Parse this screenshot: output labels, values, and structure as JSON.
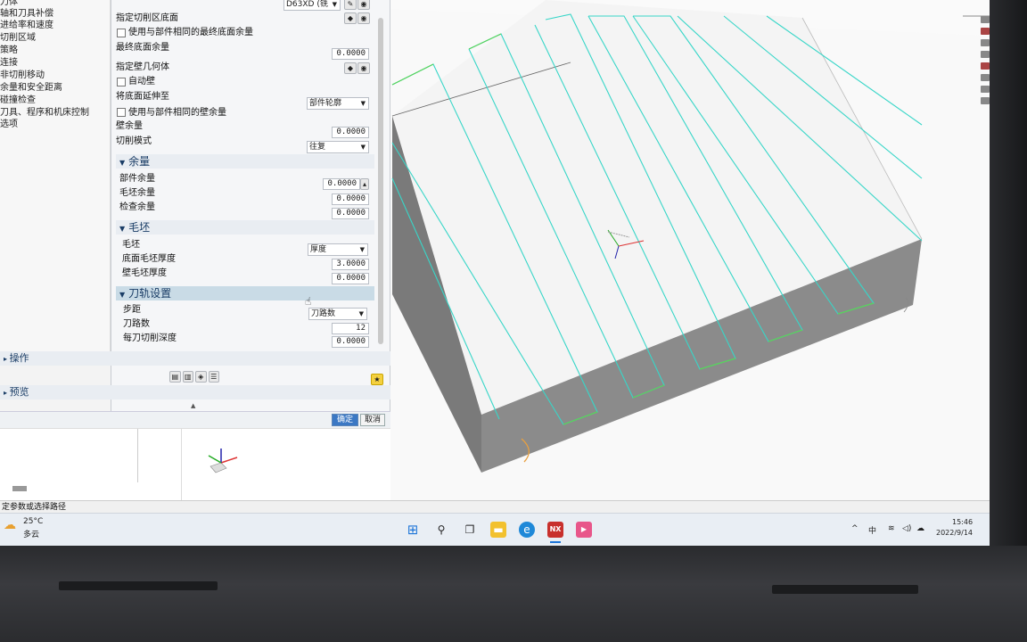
{
  "navigator": {
    "items": [
      {
        "label": "刀体"
      },
      {
        "label": "轴和刀具补偿"
      },
      {
        "label": "进给率和速度"
      },
      {
        "label": "切削区域"
      },
      {
        "label": "策略"
      },
      {
        "label": "连接"
      },
      {
        "label": "非切削移动"
      },
      {
        "label": "余量和安全距离"
      },
      {
        "label": "碰撞检查"
      },
      {
        "label": "刀具、程序和机床控制"
      },
      {
        "label": "选项"
      }
    ]
  },
  "dialog": {
    "tool_select_value": "D63XD (铣",
    "specify_floor_label": "指定切削区底面",
    "use_same_floor_stock_label": "使用与部件相同的最终底面余量",
    "final_floor_stock_label": "最终底面余量",
    "final_floor_stock_value": "0.0000",
    "specify_wall_label": "指定壁几何体",
    "auto_wall_label": "自动壁",
    "extend_floor_label": "将底面延伸至",
    "extend_floor_value": "部件轮廓",
    "use_same_wall_stock_label": "使用与部件相同的壁余量",
    "wall_stock_label": "壁余量",
    "wall_stock_value": "0.0000",
    "cut_pattern_label": "切削模式",
    "cut_pattern_value": "往复",
    "stock_section": "余量",
    "part_stock_label": "部件余量",
    "part_stock_value": "0.0000",
    "blank_stock_label": "毛坯余量",
    "blank_stock_value": "0.0000",
    "check_stock_label": "检查余量",
    "check_stock_value": "0.0000",
    "blank_section": "毛坯",
    "blank_label": "毛坯",
    "blank_value": "厚度",
    "floor_blank_thickness_label": "底面毛坯厚度",
    "floor_blank_thickness_value": "3.0000",
    "wall_blank_thickness_label": "壁毛坯厚度",
    "wall_blank_thickness_value": "0.0000",
    "toolpath_section": "刀轨设置",
    "stepover_label": "步距",
    "stepover_value": "刀路数",
    "num_passes_label": "刀路数",
    "num_passes_value": "12",
    "depth_per_cut_label": "每刀切削深度",
    "depth_per_cut_value": "0.0000",
    "operations_label": "操作",
    "preview_label": "预览",
    "ok_label": "确定",
    "cancel_label": "取消"
  },
  "status_bar": {
    "text": "定参数或选择路径"
  },
  "taskbar": {
    "weather_temp": "25°C",
    "weather_desc": "多云",
    "ime_label": "中",
    "time": "15:46",
    "date": "2022/9/14",
    "nx_label": "NX"
  },
  "colors": {
    "toolpath": "#38d6c8",
    "toolpath_highlight": "#5ad35a",
    "block_top": "#f4f4f4",
    "block_side": "#8a8a8a",
    "accent": "#2d6fc4"
  }
}
